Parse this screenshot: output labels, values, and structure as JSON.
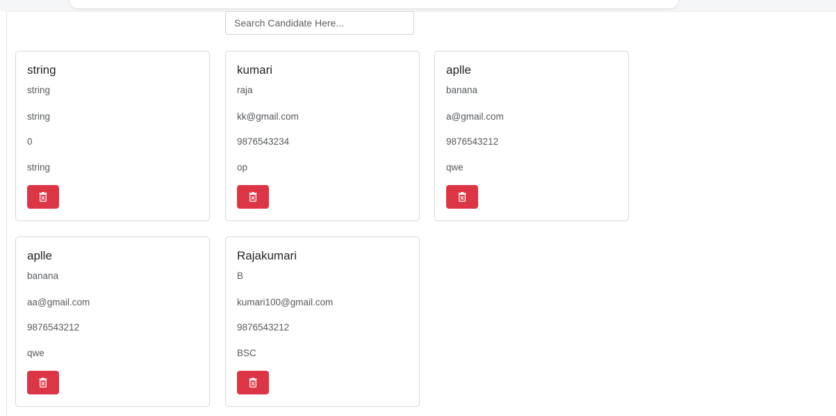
{
  "search": {
    "placeholder": "Search Candidate Here..."
  },
  "colors": {
    "delete_button": "#dc3545"
  },
  "cards": [
    {
      "name": "string",
      "field1": "string",
      "field2": "string",
      "field3": "0",
      "field4": "string",
      "delete_icon": "trash-icon"
    },
    {
      "name": "kumari",
      "field1": "raja",
      "field2": "kk@gmail.com",
      "field3": "9876543234",
      "field4": "op",
      "delete_icon": "trash-icon"
    },
    {
      "name": "aplle",
      "field1": "banana",
      "field2": "a@gmail.com",
      "field3": "9876543212",
      "field4": "qwe",
      "delete_icon": "trash-icon"
    },
    {
      "name": "aplle",
      "field1": "banana",
      "field2": "aa@gmail.com",
      "field3": "9876543212",
      "field4": "qwe",
      "delete_icon": "trash-icon"
    },
    {
      "name": "Rajakumari",
      "field1": "B",
      "field2": "kumari100@gmail.com",
      "field3": "9876543212",
      "field4": "BSC",
      "delete_icon": "trash-icon"
    }
  ]
}
